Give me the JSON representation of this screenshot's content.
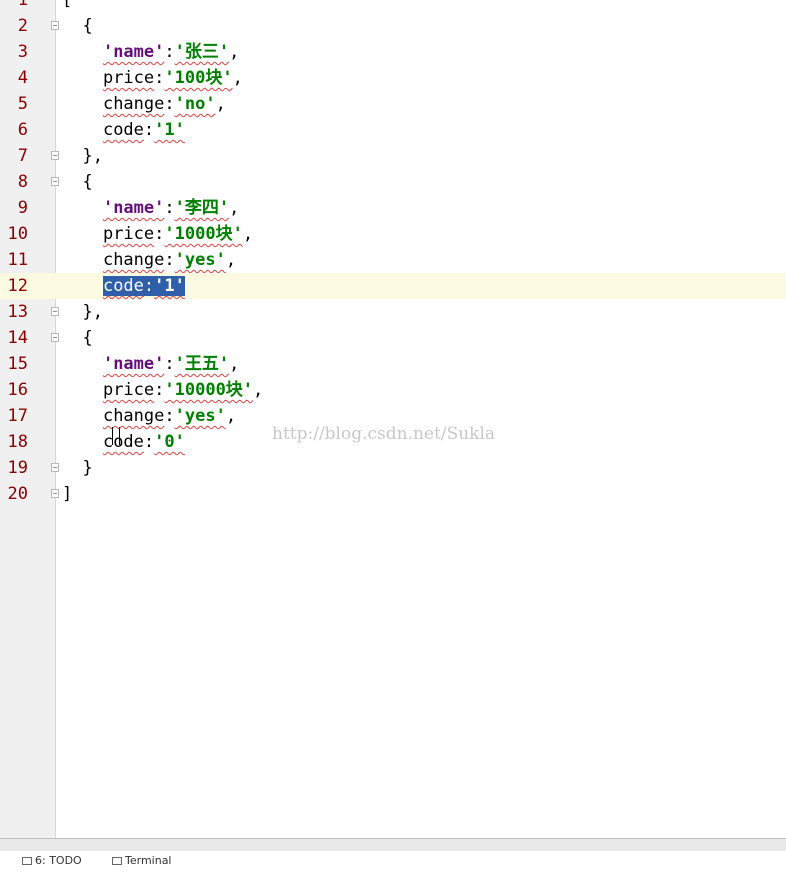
{
  "editor": {
    "lines": [
      {
        "number": "1",
        "tokens": [
          {
            "t": "[",
            "c": "punct"
          }
        ],
        "fold": false
      },
      {
        "number": "2",
        "tokens": [
          {
            "t": "  {",
            "c": "punct"
          }
        ],
        "fold": true
      },
      {
        "number": "3",
        "tokens": [
          {
            "t": "    ",
            "c": "punct"
          },
          {
            "t": "'name'",
            "c": "key-str"
          },
          {
            "t": ":",
            "c": "punct"
          },
          {
            "t": "'张三'",
            "c": "str"
          },
          {
            "t": ",",
            "c": "punct"
          }
        ],
        "fold": false
      },
      {
        "number": "4",
        "tokens": [
          {
            "t": "    ",
            "c": "punct"
          },
          {
            "t": "price",
            "c": "key"
          },
          {
            "t": ":",
            "c": "punct"
          },
          {
            "t": "'100块'",
            "c": "str"
          },
          {
            "t": ",",
            "c": "punct"
          }
        ],
        "fold": false
      },
      {
        "number": "5",
        "tokens": [
          {
            "t": "    ",
            "c": "punct"
          },
          {
            "t": "change",
            "c": "key"
          },
          {
            "t": ":",
            "c": "punct"
          },
          {
            "t": "'no'",
            "c": "str"
          },
          {
            "t": ",",
            "c": "punct"
          }
        ],
        "fold": false
      },
      {
        "number": "6",
        "tokens": [
          {
            "t": "    ",
            "c": "punct"
          },
          {
            "t": "code",
            "c": "key"
          },
          {
            "t": ":",
            "c": "punct"
          },
          {
            "t": "'1'",
            "c": "str"
          }
        ],
        "fold": false
      },
      {
        "number": "7",
        "tokens": [
          {
            "t": "  },",
            "c": "punct"
          }
        ],
        "fold": true
      },
      {
        "number": "8",
        "tokens": [
          {
            "t": "  {",
            "c": "punct"
          }
        ],
        "fold": true
      },
      {
        "number": "9",
        "tokens": [
          {
            "t": "    ",
            "c": "punct"
          },
          {
            "t": "'name'",
            "c": "key-str"
          },
          {
            "t": ":",
            "c": "punct"
          },
          {
            "t": "'李四'",
            "c": "str"
          },
          {
            "t": ",",
            "c": "punct"
          }
        ],
        "fold": false
      },
      {
        "number": "10",
        "tokens": [
          {
            "t": "    ",
            "c": "punct"
          },
          {
            "t": "price",
            "c": "key"
          },
          {
            "t": ":",
            "c": "punct"
          },
          {
            "t": "'1000块'",
            "c": "str"
          },
          {
            "t": ",",
            "c": "punct"
          }
        ],
        "fold": false
      },
      {
        "number": "11",
        "tokens": [
          {
            "t": "    ",
            "c": "punct"
          },
          {
            "t": "change",
            "c": "key"
          },
          {
            "t": ":",
            "c": "punct"
          },
          {
            "t": "'yes'",
            "c": "str"
          },
          {
            "t": ",",
            "c": "punct"
          }
        ],
        "fold": false
      },
      {
        "number": "12",
        "tokens": [
          {
            "t": "    ",
            "c": "punct"
          },
          {
            "t": "code",
            "c": "key",
            "sel": true
          },
          {
            "t": ":",
            "c": "punct",
            "sel": true
          },
          {
            "t": "'1'",
            "c": "str",
            "sel": true
          }
        ],
        "fold": false,
        "current": true
      },
      {
        "number": "13",
        "tokens": [
          {
            "t": "  },",
            "c": "punct"
          }
        ],
        "fold": true
      },
      {
        "number": "14",
        "tokens": [
          {
            "t": "  {",
            "c": "punct"
          }
        ],
        "fold": true
      },
      {
        "number": "15",
        "tokens": [
          {
            "t": "    ",
            "c": "punct"
          },
          {
            "t": "'name'",
            "c": "key-str"
          },
          {
            "t": ":",
            "c": "punct"
          },
          {
            "t": "'王五'",
            "c": "str"
          },
          {
            "t": ",",
            "c": "punct"
          }
        ],
        "fold": false
      },
      {
        "number": "16",
        "tokens": [
          {
            "t": "    ",
            "c": "punct"
          },
          {
            "t": "price",
            "c": "key"
          },
          {
            "t": ":",
            "c": "punct"
          },
          {
            "t": "'10000块'",
            "c": "str"
          },
          {
            "t": ",",
            "c": "punct"
          }
        ],
        "fold": false
      },
      {
        "number": "17",
        "tokens": [
          {
            "t": "    ",
            "c": "punct"
          },
          {
            "t": "change",
            "c": "key"
          },
          {
            "t": ":",
            "c": "punct"
          },
          {
            "t": "'yes'",
            "c": "str"
          },
          {
            "t": ",",
            "c": "punct"
          }
        ],
        "fold": false
      },
      {
        "number": "18",
        "tokens": [
          {
            "t": "    ",
            "c": "punct"
          },
          {
            "t": "code",
            "c": "key"
          },
          {
            "t": ":",
            "c": "punct"
          },
          {
            "t": "'0'",
            "c": "str"
          }
        ],
        "fold": false
      },
      {
        "number": "19",
        "tokens": [
          {
            "t": "  }",
            "c": "punct"
          }
        ],
        "fold": true
      },
      {
        "number": "20",
        "tokens": [
          {
            "t": "]",
            "c": "punct"
          }
        ],
        "fold": true
      }
    ]
  },
  "watermark": "http://blog.csdn.net/Sukla",
  "status_bar": {
    "todo_label": "6: TODO",
    "terminal_label": "Terminal"
  },
  "colors": {
    "line_number": "#8b0000",
    "string": "#008000",
    "key_string": "#660e7a",
    "selection": "#2f5fa8",
    "current_line": "#fcfae1",
    "gutter": "#f0f0f0"
  }
}
